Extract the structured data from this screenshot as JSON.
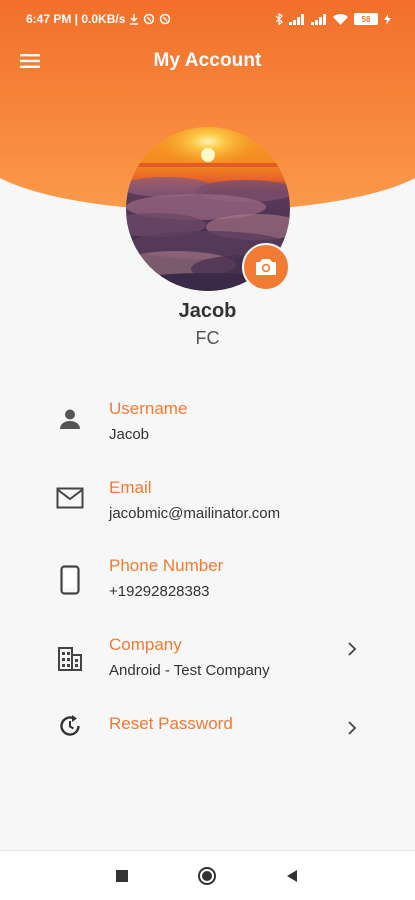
{
  "status_bar": {
    "time_and_speed": "6:47 PM | 0.0KB/s",
    "battery_level": "58"
  },
  "app_bar": {
    "title": "My Account",
    "menu_icon": "hamburger-menu-icon"
  },
  "colors": {
    "accent": "#f37a32",
    "header_gradient_top": "#f26f2a",
    "header_gradient_bottom": "#fb9a4a",
    "background": "#f7f7f7",
    "text_primary": "#333333"
  },
  "profile": {
    "name": "Jacob",
    "initials": "FC",
    "avatar_description_icon": "avatar",
    "camera_icon": "camera-icon"
  },
  "info_rows": [
    {
      "label": "Username",
      "value": "Jacob",
      "icon": "person-icon",
      "has_chevron": false
    },
    {
      "label": "Email",
      "value": "jacobmic@mailinator.com",
      "icon": "mail-icon",
      "has_chevron": false
    },
    {
      "label": "Phone Number",
      "value": "+19292828383",
      "icon": "phone-icon",
      "has_chevron": false
    },
    {
      "label": "Company",
      "value": "Android - Test Company",
      "icon": "building-icon",
      "has_chevron": true
    },
    {
      "label": "Reset Password",
      "value": "",
      "icon": "reset-icon",
      "has_chevron": true
    }
  ],
  "nav_bar": {
    "buttons": [
      "recents-square-icon",
      "home-circle-icon",
      "back-triangle-icon"
    ]
  }
}
